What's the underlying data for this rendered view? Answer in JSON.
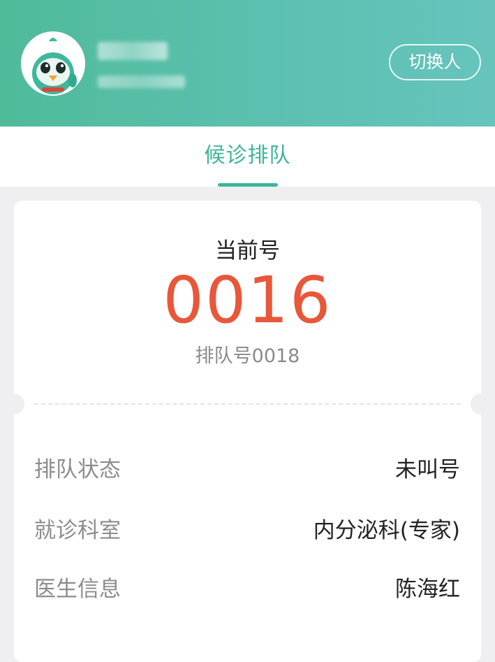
{
  "header": {
    "switch_button": "切换人",
    "avatar_icon": "bird-mascot-icon"
  },
  "tabs": [
    {
      "label": "候诊排队",
      "active": true
    }
  ],
  "queue": {
    "current_label": "当前号",
    "current_number": "0016",
    "queue_number_text": "排队号0018"
  },
  "details": [
    {
      "label": "排队状态",
      "value": "未叫号"
    },
    {
      "label": "就诊科室",
      "value": "内分泌科(专家)"
    },
    {
      "label": "医生信息",
      "value": "陈海红"
    }
  ],
  "colors": {
    "header_start": "#4fbb9a",
    "header_end": "#66c4bd",
    "accent": "#3db59a",
    "current_number": "#e8573a"
  }
}
